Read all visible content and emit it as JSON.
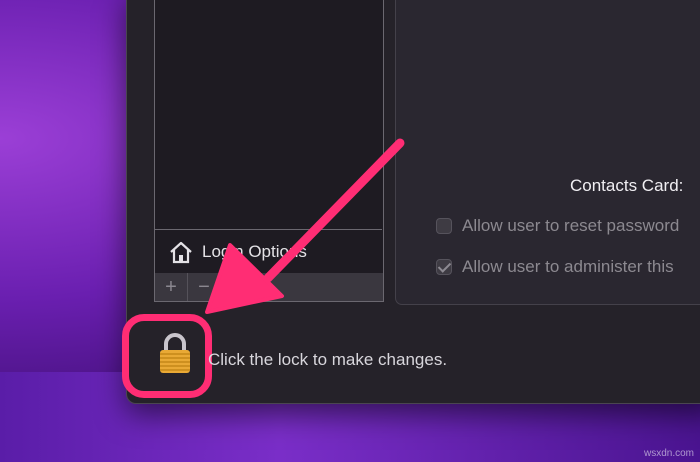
{
  "login_options": {
    "label": "Login Options",
    "icon": "house-icon"
  },
  "list_controls": {
    "add_label": "+",
    "remove_label": "−"
  },
  "contacts_card": {
    "label": "Contacts Card:"
  },
  "options": [
    {
      "label": "Allow user to reset password",
      "checked": false
    },
    {
      "label": "Allow user to administer this",
      "checked": true
    }
  ],
  "lock": {
    "label": "Click the lock to make changes.",
    "icon": "lock-icon"
  },
  "annotation": {
    "arrow_color": "#ff2d74",
    "highlight_color": "#ff2d74",
    "icon": "arrow-icon"
  },
  "watermark": "wsxdn.com"
}
